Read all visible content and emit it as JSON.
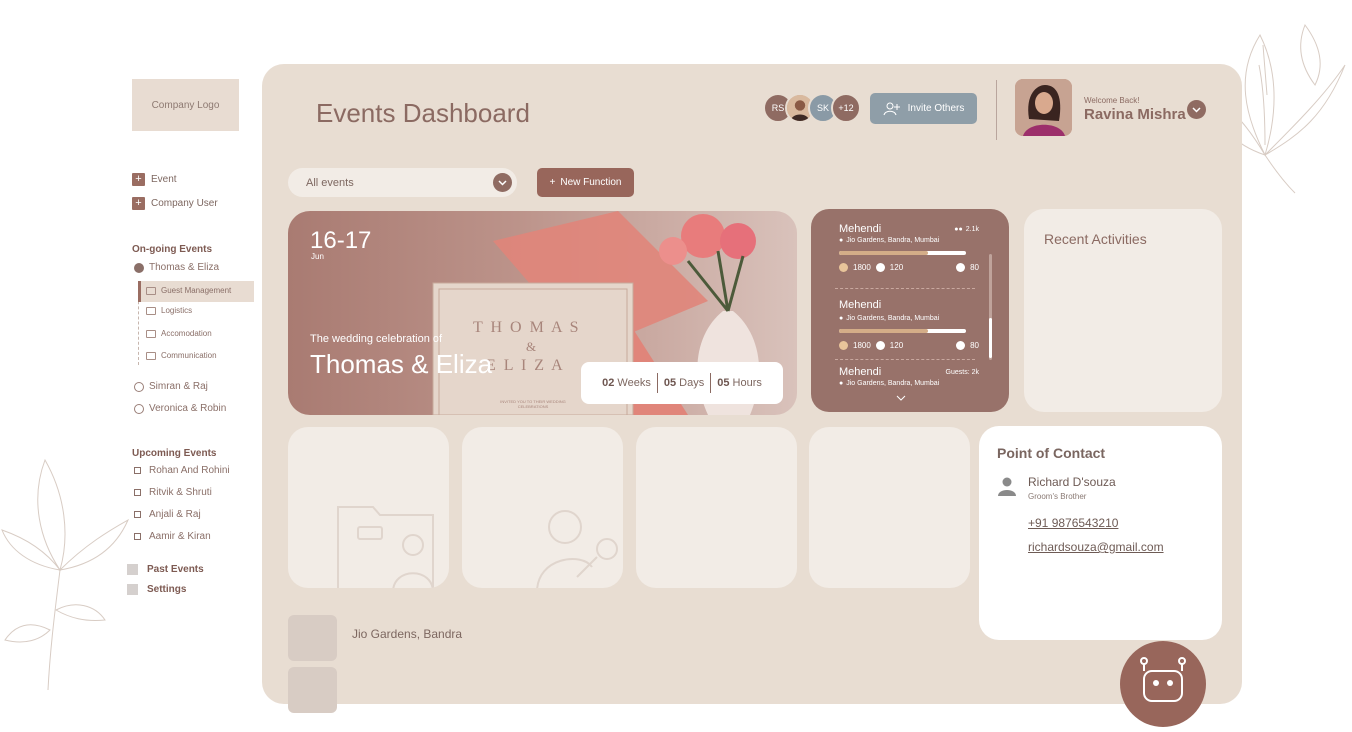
{
  "sidebar": {
    "logo": "Company Logo",
    "actions": [
      {
        "label": "Event",
        "icon": "plus-icon"
      },
      {
        "label": "Company User",
        "icon": "plus-icon"
      }
    ],
    "ongoing_heading": "On-going Events",
    "ongoing": [
      "Thomas & Eliza",
      "Simran & Raj",
      "Veronica & Robin"
    ],
    "sub_items": [
      "Guest Management",
      "Logistics",
      "Accomodation",
      "Communication"
    ],
    "upcoming_heading": "Upcoming Events",
    "upcoming": [
      "Rohan And Rohini",
      "Ritvik & Shruti",
      "Anjali & Raj",
      "Aamir & Kiran"
    ],
    "past": "Past Events",
    "settings": "Settings"
  },
  "header": {
    "title": "Events Dashboard",
    "avatars": [
      "RS",
      "SK",
      "+12"
    ],
    "invite": "Invite Others",
    "welcome": "Welcome Back!",
    "user_name": "Ravina Mishra"
  },
  "filters": {
    "select_value": "All events",
    "new_function": "New Function"
  },
  "hero": {
    "date": "16-17",
    "month": "Jun",
    "subtitle": "The wedding celebration of",
    "couple": "Thomas & Eliza",
    "card_line1": "T H O M A S",
    "card_amp": "&",
    "card_line2": "E L I Z A",
    "card_small": "INVITED YOU TO THEIR WEDDING CELEBRATIONS",
    "weeks": "02",
    "weeks_label": "Weeks",
    "days": "05",
    "days_label": "Days",
    "hours": "05",
    "hours_label": "Hours"
  },
  "functions": [
    {
      "name": "Mehendi",
      "guests": "2.1k",
      "location": "Jio Gardens, Bandra, Mumbai",
      "accepted": "1800",
      "declined": "120",
      "pending": "80",
      "progress": 0.7
    },
    {
      "name": "Mehendi",
      "location": "Jio Gardens, Bandra, Mumbai",
      "accepted": "1800",
      "declined": "120",
      "pending": "80",
      "progress": 0.7
    },
    {
      "name": "Mehendi",
      "guests": "Guests: 2k",
      "location": "Jio Gardens, Bandra, Mumbai"
    }
  ],
  "recent": {
    "title": "Recent Activities"
  },
  "contact": {
    "title": "Point of Contact",
    "name": "Richard D'souza",
    "role": "Groom's Brother",
    "phone": "+91 9876543210",
    "email": "richardsouza@gmail.com"
  },
  "venue": {
    "label": "Jio Gardens, Bandra"
  },
  "colors": {
    "accent": "#98665b",
    "panel": "#e8ddd2",
    "card": "#f2ece6",
    "invite": "#8f9ea8"
  }
}
